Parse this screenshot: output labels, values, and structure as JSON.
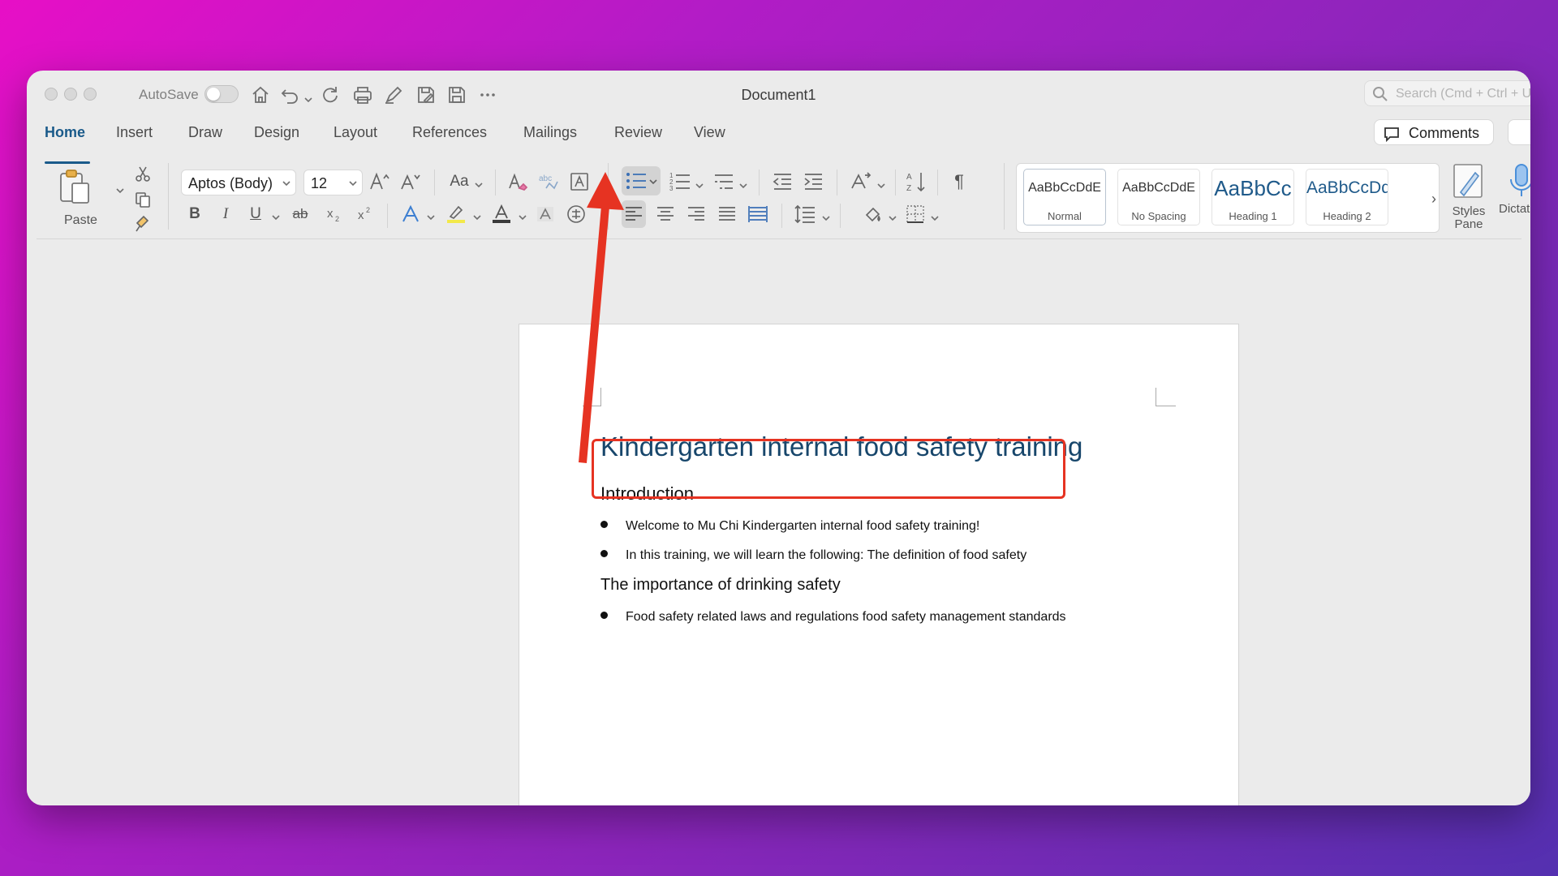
{
  "window": {
    "title": "Document1"
  },
  "titlebar": {
    "autosave_label": "AutoSave",
    "search_placeholder": "Search (Cmd + Ctrl + U)",
    "quick_access": [
      "home-icon",
      "undo-icon",
      "redo-icon",
      "print-icon",
      "pen-icon",
      "save-as-icon",
      "save-icon",
      "more-icon"
    ]
  },
  "tabs": [
    "Home",
    "Insert",
    "Draw",
    "Design",
    "Layout",
    "References",
    "Mailings",
    "Review",
    "View"
  ],
  "active_tab": "Home",
  "comments_label": "Comments",
  "ribbon": {
    "paste_label": "Paste",
    "font_name": "Aptos (Body)",
    "font_size": "12",
    "change_case": "Aa",
    "bold": "B",
    "italic": "I",
    "underline": "U",
    "strike": "ab",
    "styles": [
      {
        "preview": "AaBbCcDdE",
        "name": "Normal"
      },
      {
        "preview": "AaBbCcDdE",
        "name": "No Spacing"
      },
      {
        "preview": "AaBbCc",
        "name": "Heading 1"
      },
      {
        "preview": "AaBbCcDd",
        "name": "Heading 2"
      }
    ],
    "styles_pane_label": "Styles Pane",
    "dictate_label": "Dictate"
  },
  "document": {
    "title": "Kindergarten internal food safety training",
    "section1_heading": "Introduction",
    "section1_bullets": [
      "Welcome to Mu Chi Kindergarten internal food safety training!",
      "In this training, we will learn the following: The definition of food safety"
    ],
    "section2_heading": "The importance of drinking safety",
    "section2_bullets": [
      "Food safety related laws and regulations food safety management standards"
    ]
  },
  "colors": {
    "accent": "#1a5a8a",
    "heading_title": "#17466b",
    "annotation": "#e63322"
  }
}
